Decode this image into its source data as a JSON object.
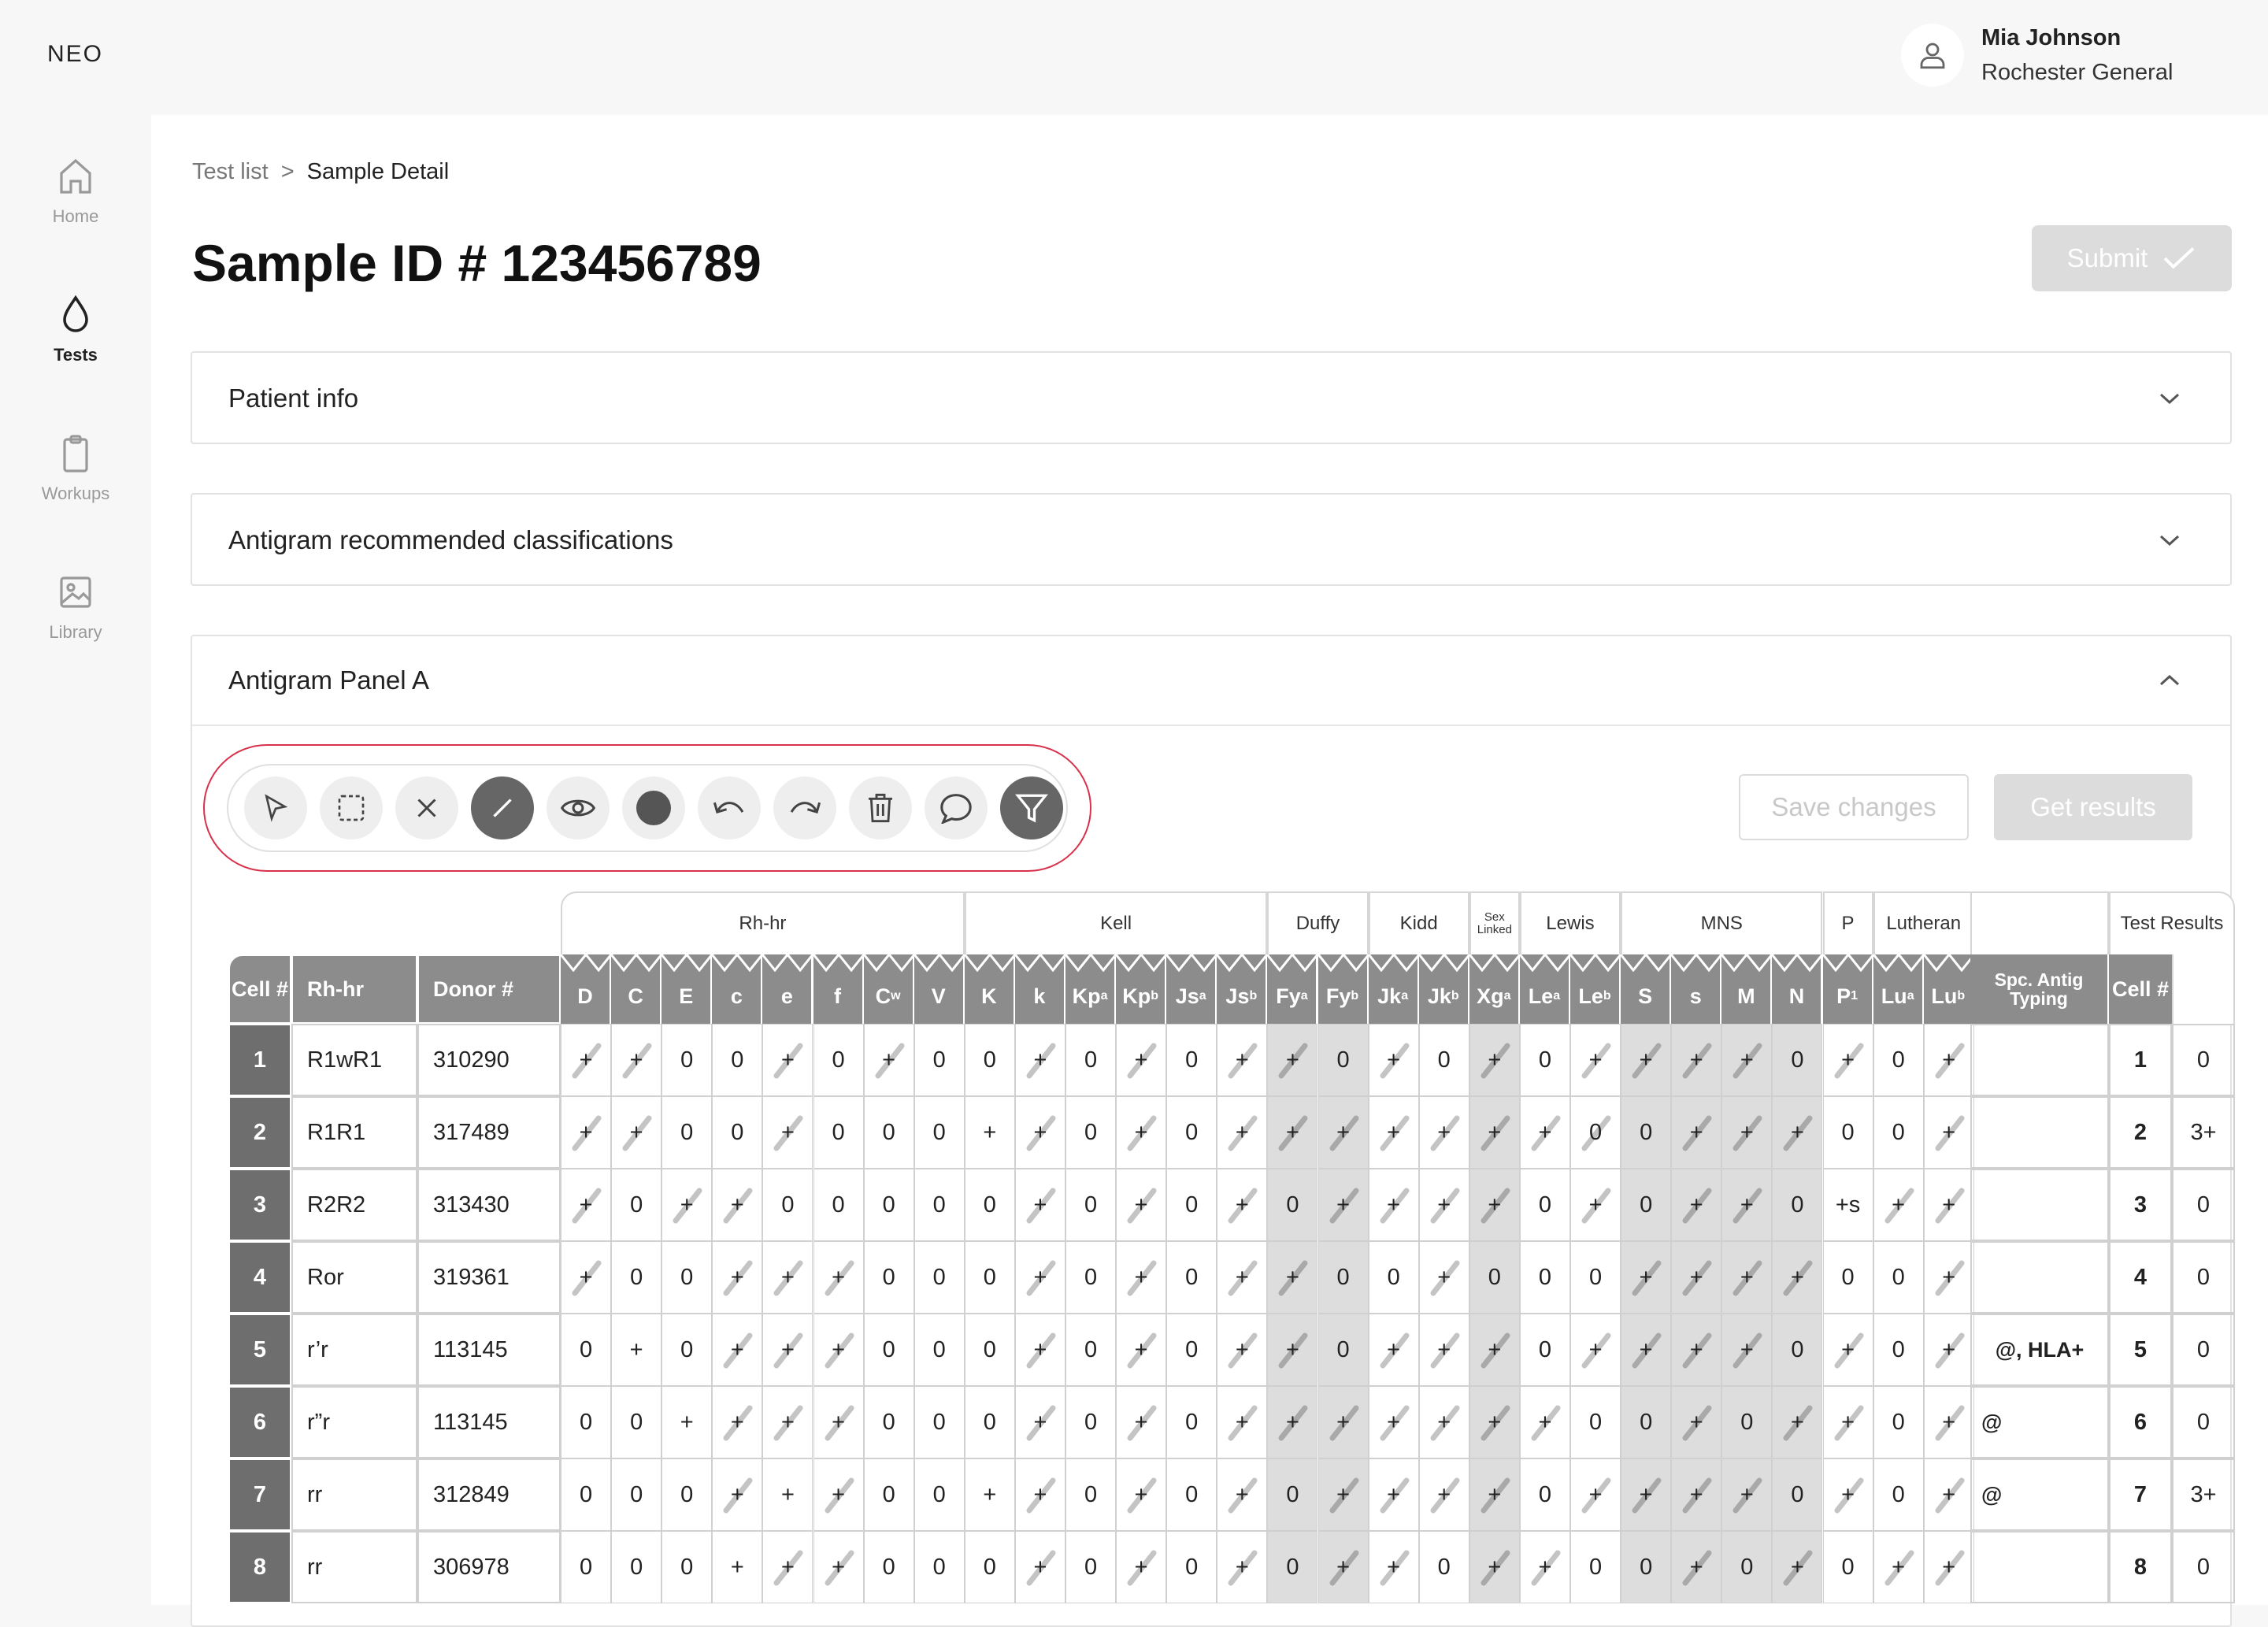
{
  "app": {
    "logo": "NEO"
  },
  "user": {
    "name": "Mia Johnson",
    "organization": "Rochester General"
  },
  "nav": [
    {
      "label": "Home",
      "icon": "home-icon",
      "active": false
    },
    {
      "label": "Tests",
      "icon": "drop-icon",
      "active": true
    },
    {
      "label": "Workups",
      "icon": "clipboard-icon",
      "active": false
    },
    {
      "label": "Library",
      "icon": "image-icon",
      "active": false
    }
  ],
  "breadcrumb": {
    "parent": "Test list",
    "separator": ">",
    "current": "Sample Detail"
  },
  "page": {
    "title": "Sample ID # 123456789",
    "submit_label": "Submit"
  },
  "sections": {
    "patient_info": "Patient info",
    "antigram_classifications": "Antigram recommended classifications",
    "antigram_panel": "Antigram Panel A"
  },
  "toolbar": {
    "tools": [
      "select-arrow-icon",
      "marquee-select-icon",
      "x-mark-icon",
      "slash-tool-icon",
      "eye-icon",
      "fill-circle-icon",
      "undo-icon",
      "redo-icon",
      "trash-icon",
      "comment-icon",
      "filter-icon"
    ],
    "save_label": "Save changes",
    "get_results_label": "Get results"
  },
  "table": {
    "groups": [
      {
        "label": "Rh-hr",
        "span": 8
      },
      {
        "label": "Kell",
        "span": 6
      },
      {
        "label": "Duffy",
        "span": 2
      },
      {
        "label": "Kidd",
        "span": 2
      },
      {
        "label": "Sex Linked",
        "span": 1
      },
      {
        "label": "Lewis",
        "span": 2
      },
      {
        "label": "MNS",
        "span": 4
      },
      {
        "label": "P",
        "span": 1
      },
      {
        "label": "Lutheran",
        "span": 2
      },
      {
        "label": "",
        "span": 1
      },
      {
        "label": "Test Results",
        "span": 2
      }
    ],
    "left_headers": [
      "Cell #",
      "Rh-hr",
      "Donor #"
    ],
    "antigens": [
      [
        "D",
        ""
      ],
      [
        "C",
        ""
      ],
      [
        "E",
        ""
      ],
      [
        "c",
        ""
      ],
      [
        "e",
        ""
      ],
      [
        "f",
        ""
      ],
      [
        "C",
        "w"
      ],
      [
        "V",
        ""
      ],
      [
        "K",
        ""
      ],
      [
        "k",
        ""
      ],
      [
        "Kp",
        "a"
      ],
      [
        "Kp",
        "b"
      ],
      [
        "Js",
        "a"
      ],
      [
        "Js",
        "b"
      ],
      [
        "Fy",
        "a"
      ],
      [
        "Fy",
        "b"
      ],
      [
        "Jk",
        "a"
      ],
      [
        "Jk",
        "b"
      ],
      [
        "Xg",
        "a"
      ],
      [
        "Le",
        "a"
      ],
      [
        "Le",
        "b"
      ],
      [
        "S",
        ""
      ],
      [
        "s",
        ""
      ],
      [
        "M",
        ""
      ],
      [
        "N",
        ""
      ],
      [
        "P",
        "1"
      ],
      [
        "Lu",
        "a"
      ],
      [
        "Lu",
        "b"
      ]
    ],
    "spc_header": "Spc. Antig Typing",
    "result_cell_header": "Cell #",
    "shaded_columns": [
      14,
      15,
      18,
      21,
      22,
      23,
      24
    ],
    "rows": [
      {
        "cell": "1",
        "rh": "R1wR1",
        "donor": "310290",
        "spc": "",
        "values": [
          "/+",
          "/+",
          "0",
          "0",
          "/+",
          "0",
          "/+",
          "0",
          "0",
          "/+",
          "0",
          "/+",
          "0",
          "/+",
          "/+",
          "0",
          "/+",
          "0",
          "/+",
          "0",
          "/+",
          "/+",
          "/+",
          "/+",
          "0",
          "/+",
          "0",
          "/+"
        ],
        "result_cell": "1",
        "result": "0"
      },
      {
        "cell": "2",
        "rh": "R1R1",
        "donor": "317489",
        "spc": "",
        "values": [
          "/+",
          "/+",
          "0",
          "0",
          "/+",
          "0",
          "0",
          "0",
          "+",
          "/+",
          "0",
          "/+",
          "0",
          "/+",
          "/+",
          "/+",
          "/+",
          "/+",
          "/+",
          "/+",
          "/0",
          "0",
          "/+",
          "/+",
          "/+",
          "0",
          "0",
          "/+"
        ],
        "result_cell": "2",
        "result": "3+"
      },
      {
        "cell": "3",
        "rh": "R2R2",
        "donor": "313430",
        "spc": "",
        "values": [
          "/+",
          "0",
          "/+",
          "/+",
          "0",
          "0",
          "0",
          "0",
          "0",
          "/+",
          "0",
          "/+",
          "0",
          "/+",
          "0",
          "/+",
          "/+",
          "/+",
          "/+",
          "0",
          "/+",
          "0",
          "/+",
          "/+",
          "0",
          "+s",
          "/+",
          "/+"
        ],
        "result_cell": "3",
        "result": "0"
      },
      {
        "cell": "4",
        "rh": "Ror",
        "donor": "319361",
        "spc": "",
        "values": [
          "/+",
          "0",
          "0",
          "/+",
          "/+",
          "/+",
          "0",
          "0",
          "0",
          "/+",
          "0",
          "/+",
          "0",
          "/+",
          "/+",
          "0",
          "0",
          "/+",
          "0",
          "0",
          "0",
          "/+",
          "/+",
          "/+",
          "/+",
          "0",
          "0",
          "/+"
        ],
        "result_cell": "4",
        "result": "0"
      },
      {
        "cell": "5",
        "rh": "r’r",
        "donor": "113145",
        "spc": "@, HLA+",
        "values": [
          "0",
          "+",
          "0",
          "/+",
          "/+",
          "/+",
          "0",
          "0",
          "0",
          "/+",
          "0",
          "/+",
          "0",
          "/+",
          "/+",
          "0",
          "/+",
          "/+",
          "/+",
          "0",
          "/+",
          "/+",
          "/+",
          "/+",
          "0",
          "/+",
          "0",
          "/+"
        ],
        "result_cell": "5",
        "result": "0"
      },
      {
        "cell": "6",
        "rh": "r”r",
        "donor": "113145",
        "spc": "@",
        "values": [
          "0",
          "0",
          "+",
          "/+",
          "/+",
          "/+",
          "0",
          "0",
          "0",
          "/+",
          "0",
          "/+",
          "0",
          "/+",
          "/+",
          "/+",
          "/+",
          "/+",
          "/+",
          "/+",
          "0",
          "0",
          "/+",
          "0",
          "/+",
          "/+",
          "0",
          "/+"
        ],
        "result_cell": "6",
        "result": "0"
      },
      {
        "cell": "7",
        "rh": "rr",
        "donor": "312849",
        "spc": "@",
        "values": [
          "0",
          "0",
          "0",
          "/+",
          "+",
          "/+",
          "0",
          "0",
          "+",
          "/+",
          "0",
          "/+",
          "0",
          "/+",
          "0",
          "/+",
          "/+",
          "/+",
          "/+",
          "0",
          "/+",
          "/+",
          "/+",
          "/+",
          "0",
          "/+",
          "0",
          "/+"
        ],
        "result_cell": "7",
        "result": "3+"
      },
      {
        "cell": "8",
        "rh": "rr",
        "donor": "306978",
        "spc": "",
        "values": [
          "0",
          "0",
          "0",
          "+",
          "/+",
          "/+",
          "0",
          "0",
          "0",
          "/+",
          "0",
          "/+",
          "0",
          "/+",
          "0",
          "/+",
          "/+",
          "0",
          "/+",
          "/+",
          "0",
          "0",
          "/+",
          "0",
          "/+",
          "0",
          "/+",
          "/+"
        ],
        "result_cell": "8",
        "result": "0"
      }
    ]
  },
  "colors": {
    "accent_ring": "#d8314b",
    "header_gray": "#8c8c8c",
    "dark_cell": "#6e6e6e",
    "shaded_column": "#dddddd"
  }
}
